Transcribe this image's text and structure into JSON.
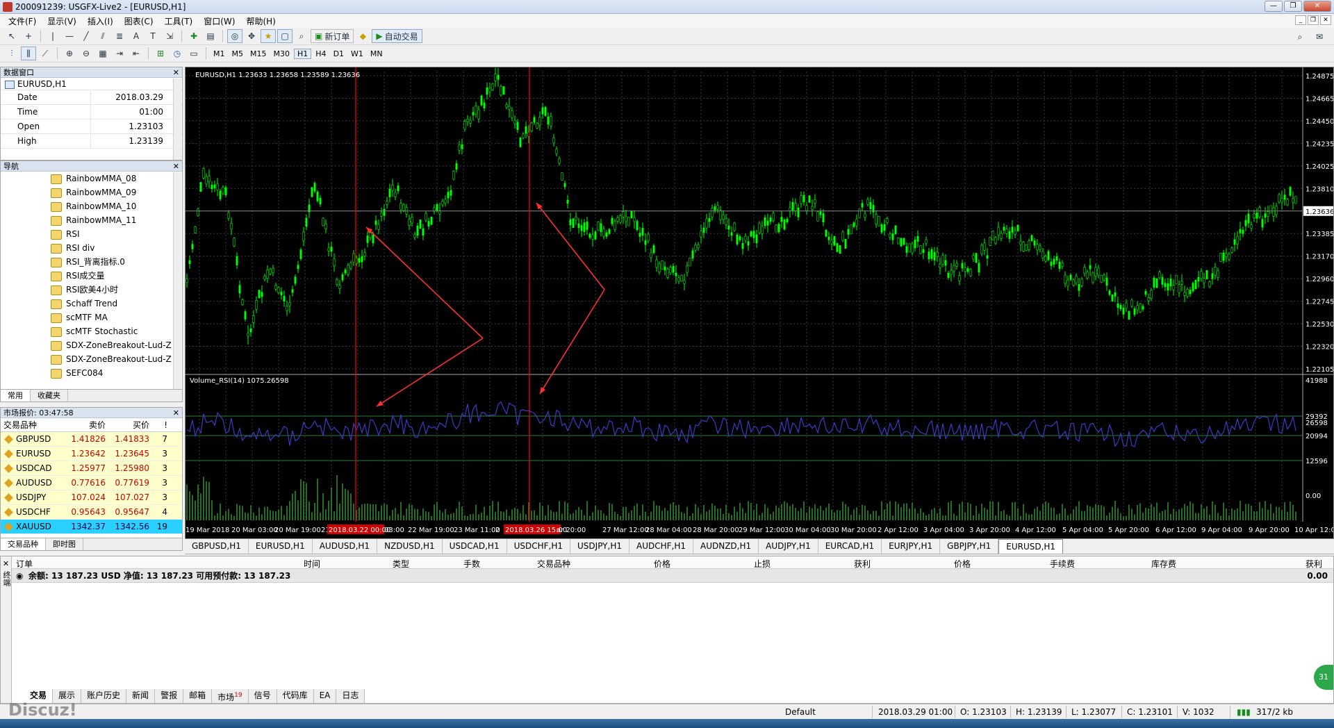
{
  "window": {
    "title": "200091239: USGFX-Live2 - [EURUSD,H1]"
  },
  "menu": [
    "文件(F)",
    "显示(V)",
    "插入(I)",
    "图表(C)",
    "工具(T)",
    "窗口(W)",
    "帮助(H)"
  ],
  "toolbar": {
    "new_order": "新订单",
    "auto_trade": "自动交易",
    "timeframes": [
      "M1",
      "M5",
      "M15",
      "M30",
      "H1",
      "H4",
      "D1",
      "W1",
      "MN"
    ],
    "selected_tf": "H1"
  },
  "data_window": {
    "title": "数据窗口",
    "symbol": "EURUSD,H1",
    "rows": [
      {
        "k": "Date",
        "v": "2018.03.29"
      },
      {
        "k": "Time",
        "v": "01:00"
      },
      {
        "k": "Open",
        "v": "1.23103"
      },
      {
        "k": "High",
        "v": "1.23139"
      }
    ]
  },
  "navigator": {
    "title": "导航",
    "items": [
      "RainbowMMA_08",
      "RainbowMMA_09",
      "RainbowMMA_10",
      "RainbowMMA_11",
      "RSI",
      "RSI div",
      "RSI_背离指标.0",
      "RSI成交量",
      "RSI欧美4小时",
      "Schaff Trend",
      "scMTF MA",
      "scMTF Stochastic",
      "SDX-ZoneBreakout-Lud-Z",
      "SDX-ZoneBreakout-Lud-Z",
      "SEFC084"
    ],
    "tabs": [
      "常用",
      "收藏夹"
    ]
  },
  "market_watch": {
    "title": "市场报价: 03:47:58",
    "headers": [
      "交易品种",
      "卖价",
      "买价",
      "!"
    ],
    "rows": [
      {
        "s": "GBPUSD",
        "b": "1.41826",
        "a": "1.41833",
        "sp": "7"
      },
      {
        "s": "EURUSD",
        "b": "1.23642",
        "a": "1.23645",
        "sp": "3"
      },
      {
        "s": "USDCAD",
        "b": "1.25977",
        "a": "1.25980",
        "sp": "3"
      },
      {
        "s": "AUDUSD",
        "b": "0.77616",
        "a": "0.77619",
        "sp": "3"
      },
      {
        "s": "USDJPY",
        "b": "107.024",
        "a": "107.027",
        "sp": "3"
      },
      {
        "s": "USDCHF",
        "b": "0.95643",
        "a": "0.95647",
        "sp": "4"
      },
      {
        "s": "XAUUSD",
        "b": "1342.37",
        "a": "1342.56",
        "sp": "19"
      }
    ],
    "tabs": [
      "交易品种",
      "即时图"
    ]
  },
  "chart": {
    "header": "EURUSD,H1  1.23633 1.23658 1.23589 1.23636",
    "sub_header": "Volume_RSI(14) 1075.26598",
    "price_labels": [
      "1.24875",
      "1.24665",
      "1.24450",
      "1.24235",
      "1.24025",
      "1.23810",
      "1.23636",
      "1.23385",
      "1.23170",
      "1.22960",
      "1.22745",
      "1.22530",
      "1.22320",
      "1.22105"
    ],
    "current_price": "1.23636",
    "sub_labels": [
      "41988",
      "29392",
      "26598",
      "20994",
      "12596",
      "0.00"
    ],
    "time_labels": [
      "19 Mar 2018",
      "20 Mar 03:00",
      "20 Mar 19:00",
      "21",
      "2018.03.22 00:00",
      "03:00",
      "22 Mar 19:00",
      "23 Mar 11:00",
      "2",
      "2018.03.26 15:00",
      "ar 20:00",
      "27 Mar 12:00",
      "28 Mar 04:00",
      "28 Mar 20:00",
      "29 Mar 12:00",
      "30 Mar 04:00",
      "30 Mar 20:00",
      "2 Apr 12:00",
      "3 Apr 04:00",
      "3 Apr 20:00",
      "4 Apr 12:00",
      "5 Apr 04:00",
      "5 Apr 20:00",
      "6 Apr 12:00",
      "9 Apr 04:00",
      "9 Apr 20:00",
      "10 Apr 12:00"
    ]
  },
  "chart_tabs": [
    "GBPUSD,H1",
    "EURUSD,H1",
    "AUDUSD,H1",
    "NZDUSD,H1",
    "USDCAD,H1",
    "USDCHF,H1",
    "USDJPY,H1",
    "AUDCHF,H1",
    "AUDNZD,H1",
    "AUDJPY,H1",
    "EURCAD,H1",
    "EURJPY,H1",
    "GBPJPY,H1",
    "EURUSD,H1"
  ],
  "terminal": {
    "headers": [
      "订单",
      "时间",
      "类型",
      "手数",
      "交易品种",
      "价格",
      "止损",
      "获利",
      "价格",
      "手续费",
      "库存费",
      "获利"
    ],
    "balance": "余额: 13 187.23 USD  净值: 13 187.23  可用预付款: 13 187.23",
    "total": "0.00",
    "tabs": [
      "交易",
      "展示",
      "账户历史",
      "新闻",
      "警报",
      "邮箱",
      "市场",
      "信号",
      "代码库",
      "EA",
      "日志"
    ],
    "market_badge": "19",
    "side": "终端"
  },
  "status": {
    "profile": "Default",
    "datetime": "2018.03.29 01:00",
    "open": "O: 1.23103",
    "high": "H: 1.23139",
    "low": "L: 1.23077",
    "close": "C: 1.23101",
    "volume": "V: 1032",
    "traffic": "317/2 kb"
  },
  "watermark": "Discuz!",
  "colors": {
    "bull": "#00ff00",
    "bear": "#00ff00",
    "rsi": "#3b3bc8",
    "arrow": "#ff3030",
    "vline": "#ff0000",
    "bid": "#c00000"
  }
}
